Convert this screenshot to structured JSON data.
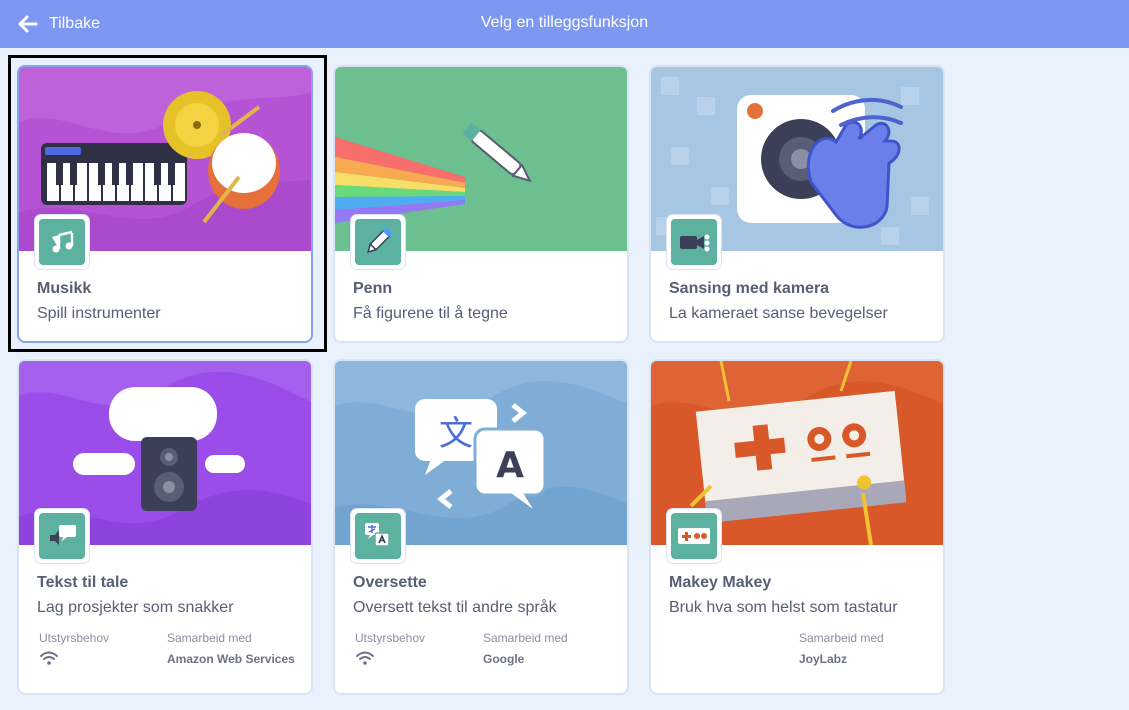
{
  "header": {
    "back_label": "Tilbake",
    "title": "Velg en tilleggsfunksjon"
  },
  "cards": [
    {
      "name": "Musikk",
      "description": "Spill instrumenter"
    },
    {
      "name": "Penn",
      "description": "Få figurene til å tegne"
    },
    {
      "name": "Sansing med kamera",
      "description": "La kameraet sanse bevegelser"
    },
    {
      "name": "Tekst til tale",
      "description": "Lag prosjekter som snakker",
      "requirements_label": "Utstyrsbehov",
      "collaboration_label": "Samarbeid med",
      "collaborator": "Amazon Web Services"
    },
    {
      "name": "Oversette",
      "description": "Oversett tekst til andre språk",
      "requirements_label": "Utstyrsbehov",
      "collaboration_label": "Samarbeid med",
      "collaborator": "Google"
    },
    {
      "name": "Makey Makey",
      "description": "Bruk hva som helst som tastatur",
      "collaboration_label": "Samarbeid med",
      "collaborator": "JoyLabz"
    }
  ],
  "illustration_text": {
    "translate_glyph_zh": "文",
    "translate_glyph_a": "A"
  },
  "colors": {
    "header": "#7d98f3",
    "background": "#e9f1fc",
    "icon_bg": "#5cb1a0",
    "music_bg": "#b653d4",
    "pen_bg": "#6cbf8e",
    "camera_bg": "#a7c6e4",
    "tts_bg": "#9a4de8",
    "translate_bg": "#7fadd6",
    "makey_bg": "#d9582a",
    "text": "#575e75"
  },
  "icons": [
    "back-arrow-icon",
    "music-notes-icon",
    "pen-icon",
    "camera-icon",
    "speaker-icon",
    "translate-icon",
    "makey-board-icon",
    "wifi-icon"
  ]
}
